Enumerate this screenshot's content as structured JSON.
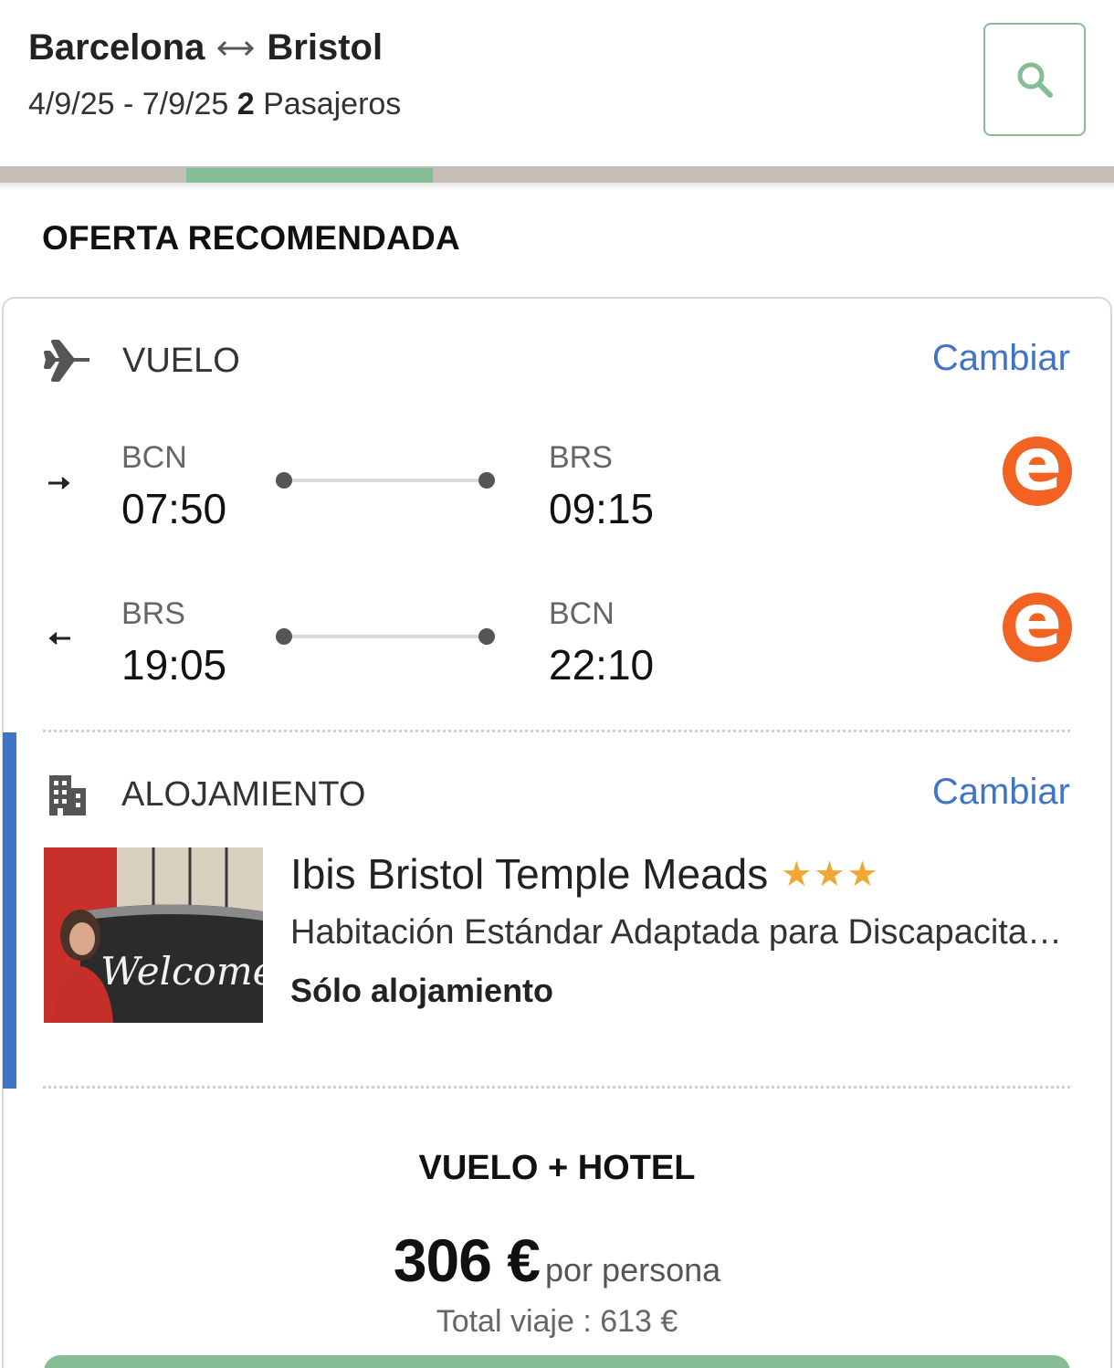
{
  "header": {
    "origin": "Barcelona",
    "destination": "Bristol",
    "dates": "4/9/25 - 7/9/25",
    "passengers_count": "2",
    "passengers_label": "Pasajeros"
  },
  "progress": {
    "fraction": 0.22
  },
  "offer": {
    "title": "OFERTA RECOMENDADA"
  },
  "flight": {
    "label": "VUELO",
    "change_label": "Cambiar",
    "outbound": {
      "from": "BCN",
      "dep": "07:50",
      "to": "BRS",
      "arr": "09:15",
      "airline_icon": "easyjet-logo-icon"
    },
    "inbound": {
      "from": "BRS",
      "dep": "19:05",
      "to": "BCN",
      "arr": "22:10",
      "airline_icon": "easyjet-logo-icon"
    },
    "airline_letter": "e"
  },
  "hotel": {
    "label": "ALOJAMIENTO",
    "change_label": "Cambiar",
    "name": "Ibis Bristol Temple Meads",
    "stars": 3,
    "stars_text": "★★★",
    "room": "Habitación Estándar Adaptada para Discapacitados",
    "board": "Sólo alojamiento",
    "photo_text": "Welcome"
  },
  "package": {
    "title": "VUELO + HOTEL",
    "price": "306 €",
    "per_person": "por persona",
    "total": "Total viaje : 613 €"
  },
  "colors": {
    "accent_green": "#86bd94",
    "link_blue": "#3f74c6",
    "easyjet_orange": "#f26222",
    "star_gold": "#f0a834"
  }
}
